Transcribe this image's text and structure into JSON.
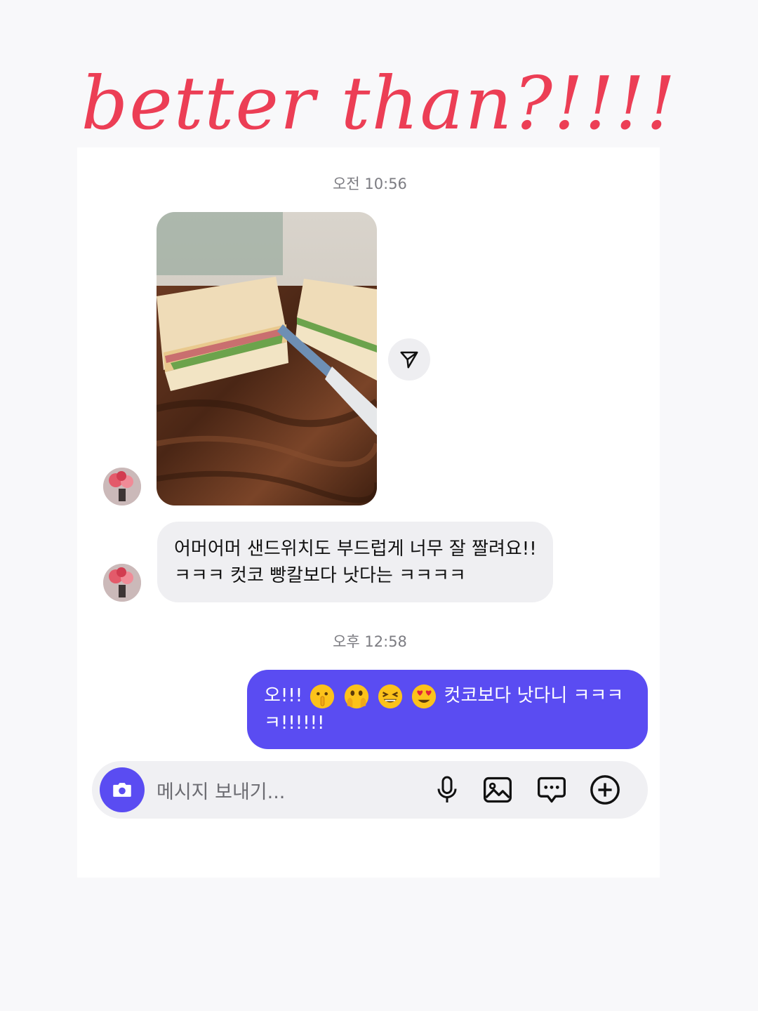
{
  "headline": "better than?!!!!",
  "conversation": {
    "timestamp_1": "오전 10:56",
    "timestamp_2": "오후 12:58",
    "incoming_message": "어머어머 샌드위치도 부드럽게 너무 잘 짤려요!! ㅋㅋㅋ 컷코 빵칼보다 낫다는 ㅋㅋㅋㅋ",
    "outgoing_message": {
      "prefix": "오!!!",
      "emojis": [
        "shushing-face",
        "face-with-hand-over-mouth-eyes",
        "grinning-squinting-face",
        "heart-eyes-face"
      ],
      "suffix": "컷코보다 낫다니 ㅋㅋㅋㅋ!!!!!!"
    },
    "photo_description_icon": "sandwich-photo"
  },
  "composer": {
    "placeholder": "메시지 보내기...",
    "icons": [
      "camera-icon",
      "microphone-icon",
      "image-icon",
      "sticker-icon",
      "plus-icon"
    ]
  },
  "colors": {
    "accent": "#5a4cf2",
    "headline": "#ec3e55",
    "incoming_bubble": "#efeff2"
  }
}
